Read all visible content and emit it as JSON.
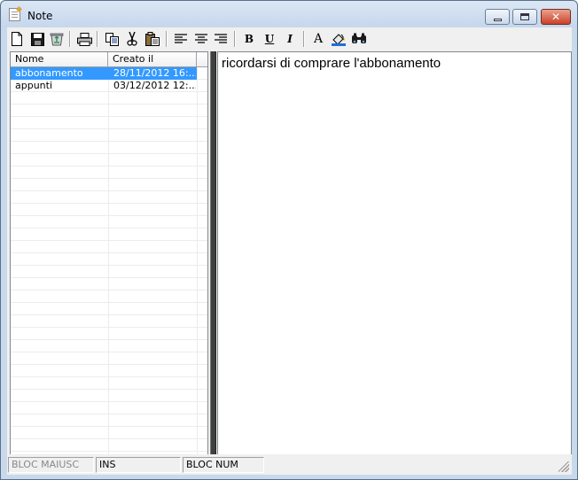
{
  "window": {
    "title": "Note"
  },
  "toolbar": {
    "groups": [
      [
        "new-document-icon",
        "save-icon",
        "recycle-bin-icon"
      ],
      [
        "print-icon"
      ],
      [
        "copy-icon",
        "cut-icon",
        "paste-icon"
      ],
      [
        "align-left-icon",
        "align-center-icon",
        "align-right-icon"
      ],
      [
        "bold-icon",
        "underline-icon",
        "italic-icon"
      ],
      [
        "font-icon",
        "color-fill-icon",
        "find-icon"
      ]
    ],
    "bold_label": "B",
    "underline_label": "U",
    "italic_label": "I",
    "font_label": "A"
  },
  "list": {
    "columns": [
      "Nome",
      "Creato il"
    ],
    "rows": [
      {
        "nome": "abbonamento",
        "creato": "28/11/2012 16:...",
        "selected": true
      },
      {
        "nome": "appunti",
        "creato": "03/12/2012 12:...",
        "selected": false
      }
    ]
  },
  "editor": {
    "text": "ricordarsi di comprare l'abbonamento"
  },
  "statusbar": {
    "caps": "BLOC MAIUSC",
    "ins": "INS",
    "num": "BLOC NUM"
  },
  "colors": {
    "selection": "#3399ff",
    "splitter": "#404040",
    "titlebar": "#c5d7ec",
    "close_button": "#c9412a"
  }
}
